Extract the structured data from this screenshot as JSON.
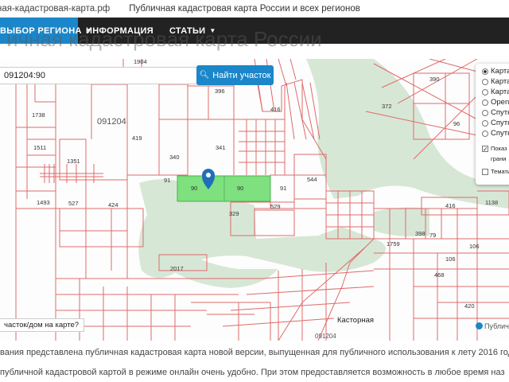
{
  "header": {
    "site": "ная-кадастровая-карта.рф",
    "tagline": "Публичная кадастровая карта России и всех регионов"
  },
  "nav": {
    "items": [
      {
        "label": "ВЫБОР РЕГИОНА"
      },
      {
        "label": "ИНФОРМАЦИЯ"
      },
      {
        "label": "СТАТЬИ"
      }
    ],
    "ghost_title": "ичная кадастровая карта России"
  },
  "search": {
    "value": "091204:90",
    "button_label": "Найти участок"
  },
  "map": {
    "quarter_label": "091204",
    "selected_parcel_labels": [
      "90",
      "90"
    ],
    "parcel_labels": [
      "1904",
      "396",
      "416",
      "372",
      "390",
      "96",
      "1738",
      "1511",
      "1351",
      "419",
      "340",
      "341",
      "544",
      "1493",
      "527",
      "424",
      "329",
      "529",
      "416",
      "1138",
      "398",
      "79",
      "1759",
      "106",
      "106",
      "468",
      "2017",
      "420",
      "91",
      "91"
    ],
    "town_label": "Касторная",
    "town_code": "091204",
    "colors": {
      "parcel_line": "#e06a6a",
      "forest": "#d7e7d6",
      "selected": "#7ee07e",
      "marker": "#1f6fb8"
    }
  },
  "layers": {
    "base": [
      {
        "label": "Карта",
        "selected": true
      },
      {
        "label": "Карта",
        "selected": false
      },
      {
        "label": "Карта",
        "selected": false
      },
      {
        "label": "Openst",
        "selected": false
      },
      {
        "label": "Спутн",
        "selected": false
      },
      {
        "label": "Спутн",
        "selected": false
      },
      {
        "label": "Спутн",
        "selected": false
      }
    ],
    "overlays": [
      {
        "label": "Показ",
        "sub": "грани",
        "checked": true
      },
      {
        "label": "Темати",
        "checked": false
      }
    ]
  },
  "what_is_here": "часток/дом на карте?",
  "attribution": "Публичн",
  "content": {
    "line1": "вания представлена публичная кадастровая карта новой версии, выпущенная для публичного использования к лету 2016 год",
    "line2": "публичной кадастровой картой в режиме онлайн очень удобно. При этом предоставляется возможность в любое время наз"
  }
}
